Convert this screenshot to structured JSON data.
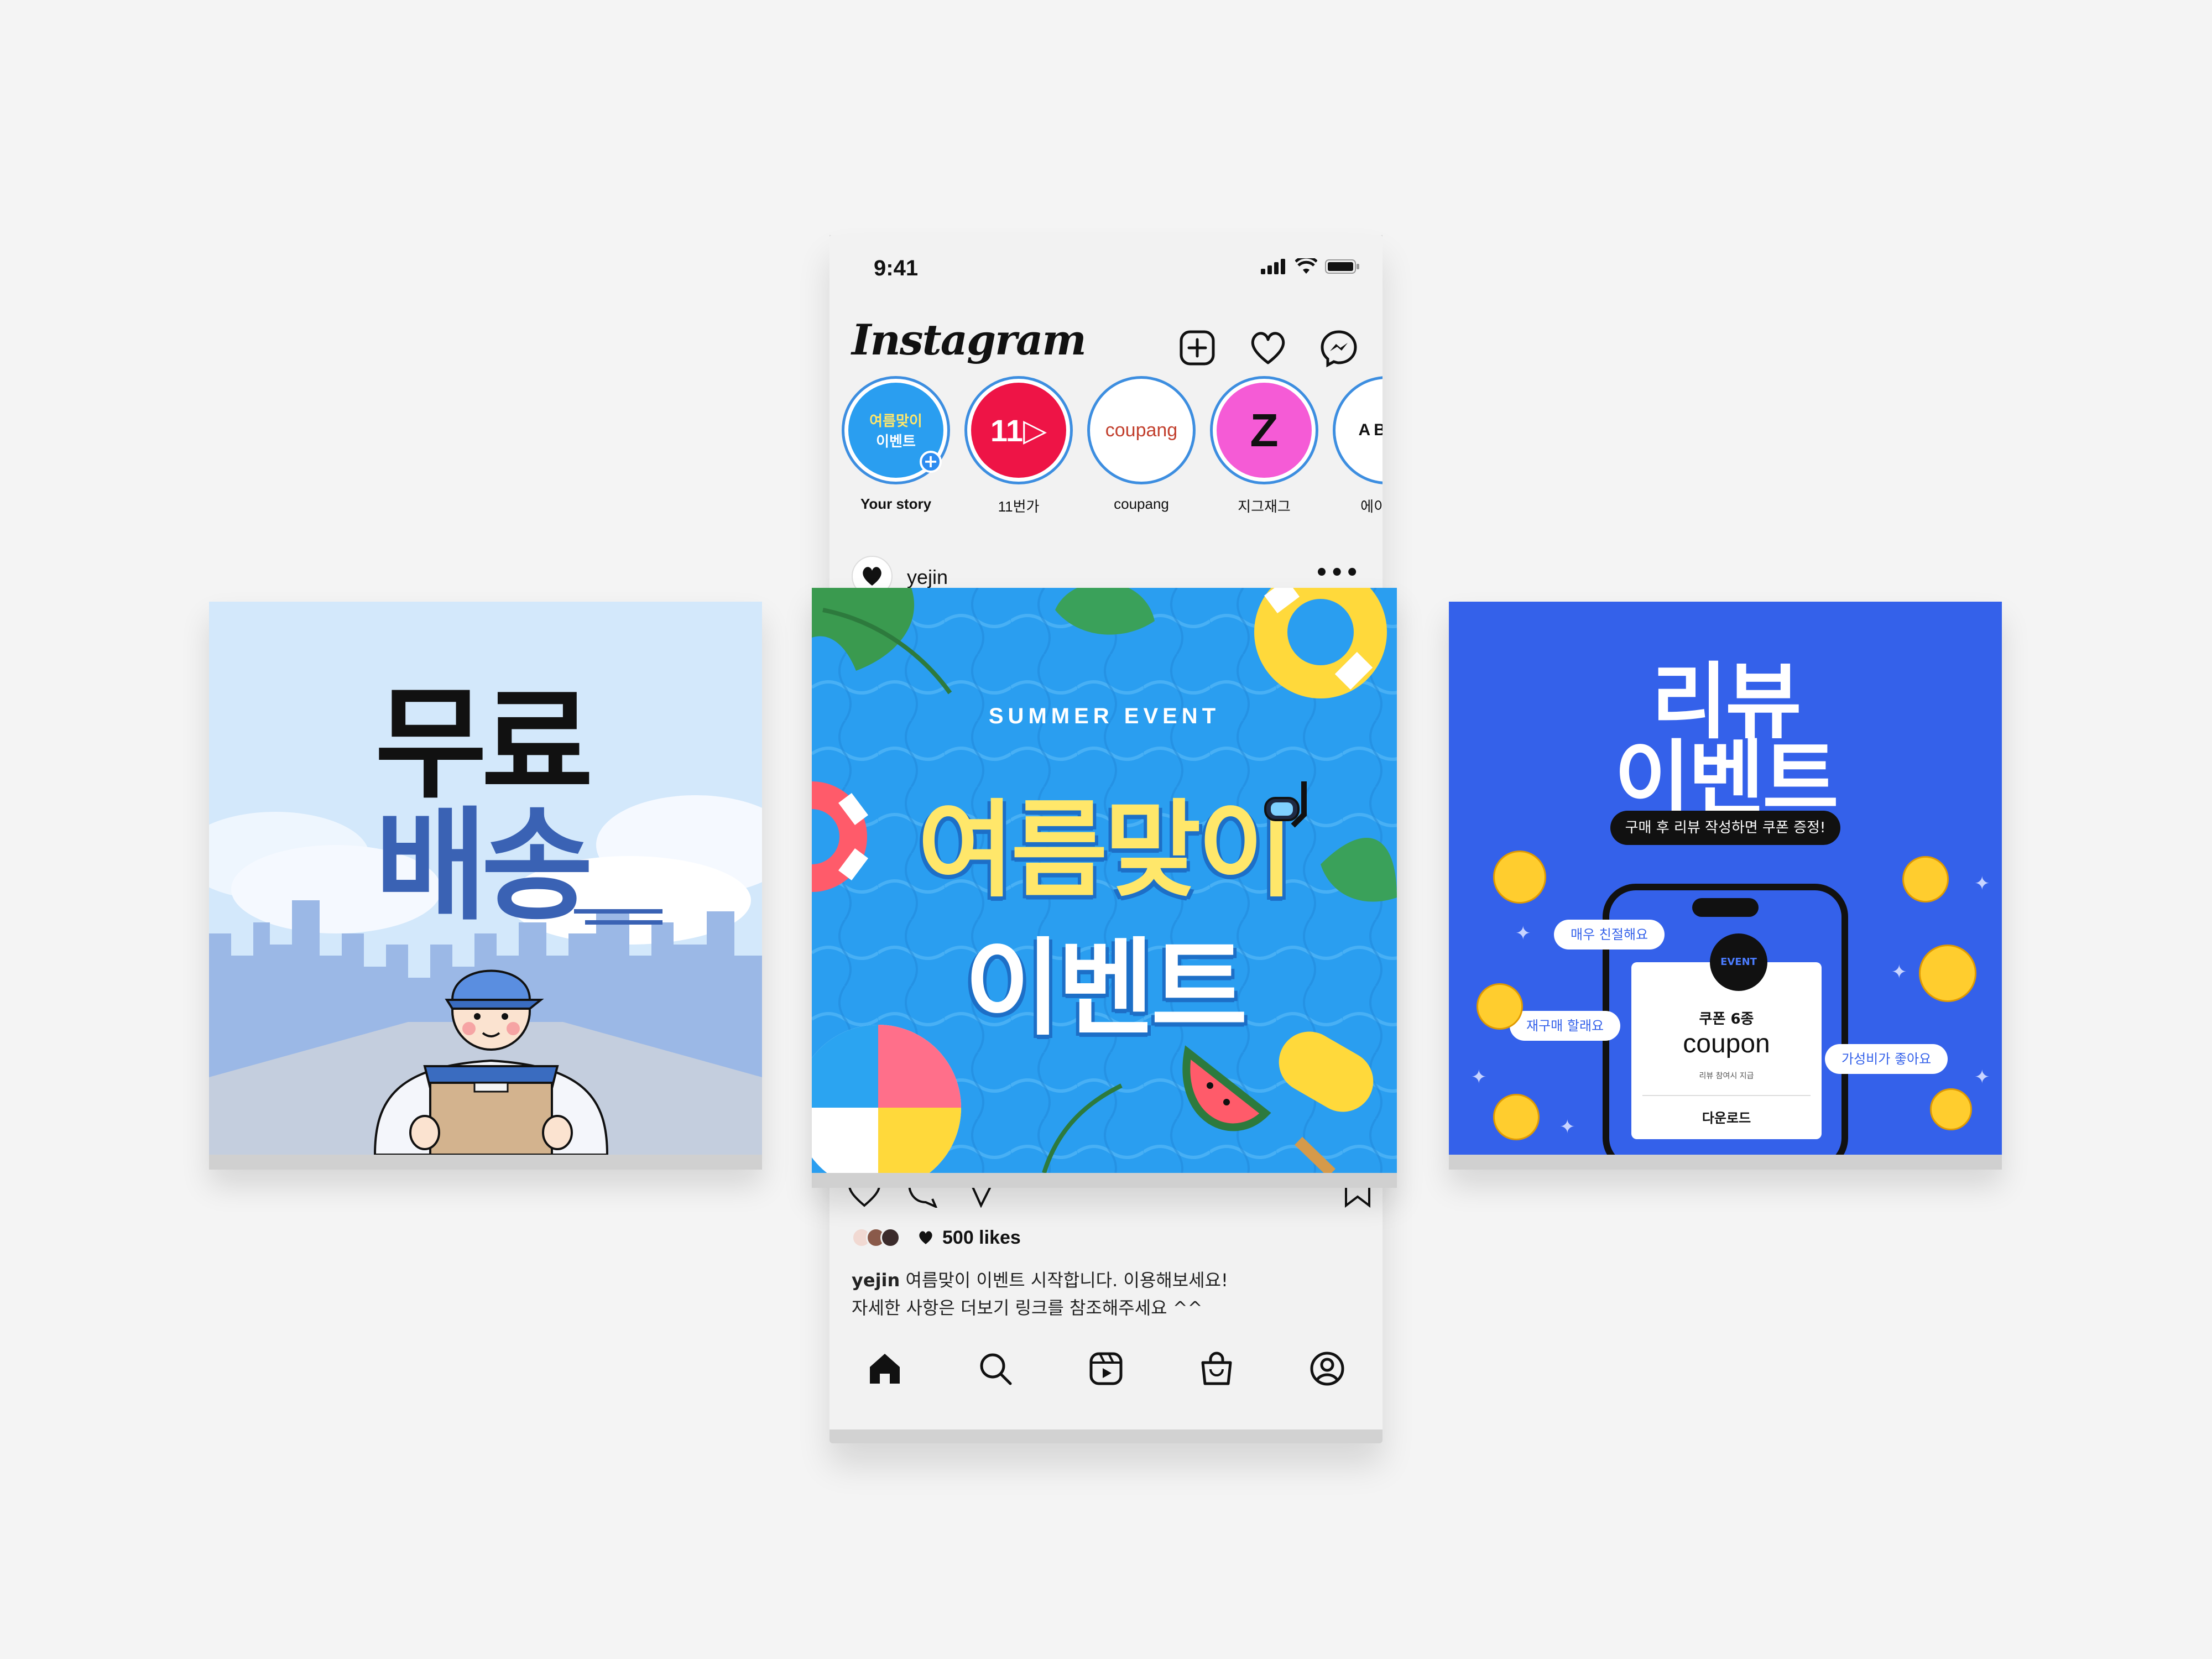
{
  "status_bar": {
    "time": "9:41"
  },
  "header": {
    "logo": "Instagram"
  },
  "header_icons": [
    "new-post-icon",
    "heart-icon",
    "messenger-icon"
  ],
  "stories": [
    {
      "label": "Your story",
      "thumb_line1": "여름맞이",
      "thumb_line2": "이벤트"
    },
    {
      "label": "11번가",
      "thumb": "11"
    },
    {
      "label": "coupang",
      "thumb": "coupang"
    },
    {
      "label": "지그재그",
      "thumb": "Z"
    },
    {
      "label": "에이블리",
      "thumb": "ABLY"
    }
  ],
  "post": {
    "username": "yejin",
    "more": "•••",
    "likes": "500 likes",
    "caption_user": "yejin",
    "caption_line1": "여름맞이 이벤트 시작합니다. 이용해보세요!",
    "caption_line2": "자세한 사항은 더보기 링크를 참조해주세요 ^^"
  },
  "tab_bar": [
    "home-icon",
    "search-icon",
    "reels-icon",
    "shop-icon",
    "profile-icon"
  ],
  "card_left": {
    "line1": "무료",
    "line2": "배송"
  },
  "card_center": {
    "label": "SUMMER EVENT",
    "line1": "여름맞이",
    "line2": "이벤트"
  },
  "card_right": {
    "line1": "리뷰",
    "line2": "이벤트",
    "pill": "구매 후 리뷰 작성하면 쿠폰 증정!",
    "badge": "EVENT",
    "card_sub": "쿠폰 6종",
    "card_main": "coupon",
    "card_small": "리뷰 참여시 지급",
    "card_button": "다운로드",
    "bubble1": "매우 친절해요",
    "bubble2": "재구매 할래요",
    "bubble3": "가성비가 좋아요"
  },
  "colors": {
    "accent_blue": "#3461ea",
    "story_ring": "#3d8ee0",
    "summer_yellow": "#ffe76a",
    "free_blue": "#3a62b4"
  }
}
